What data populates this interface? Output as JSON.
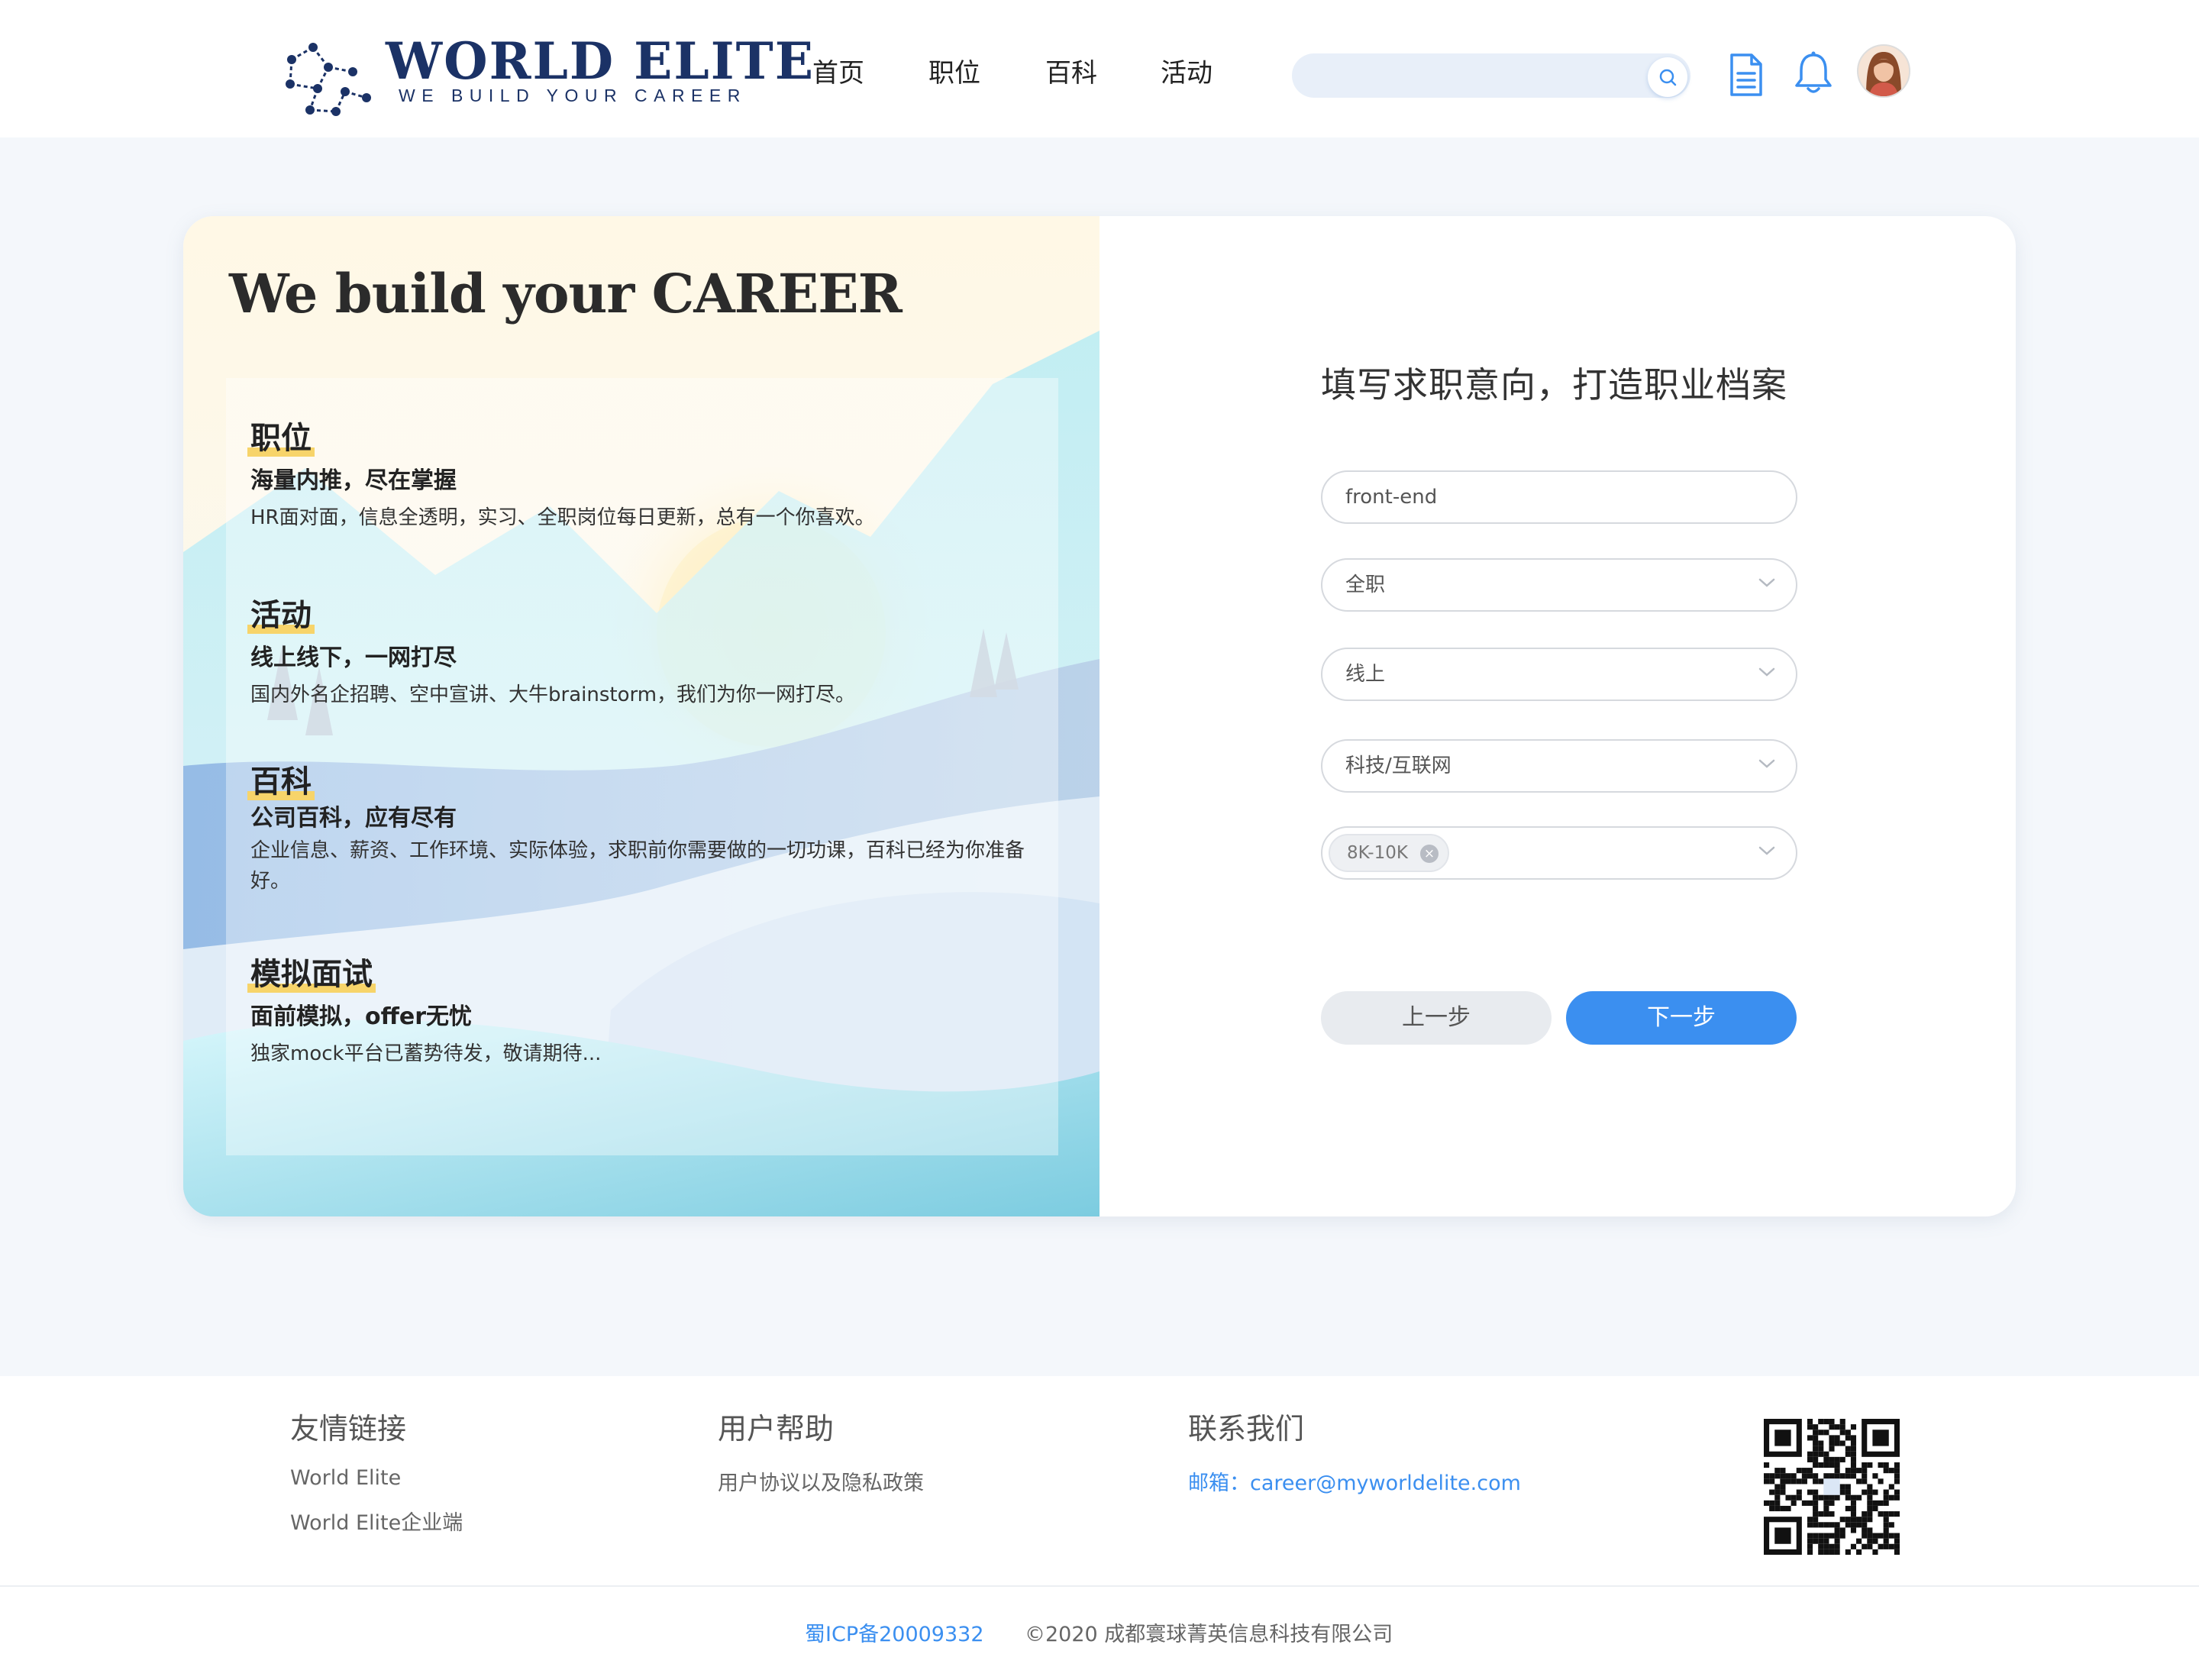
{
  "header": {
    "logo_title": "WORLD ELITE",
    "logo_subtitle": "WE BUILD YOUR CAREER",
    "nav": [
      "首页",
      "职位",
      "百科",
      "活动"
    ],
    "search_placeholder": ""
  },
  "hero": {
    "headline": "We build your CAREER",
    "features": [
      {
        "title": "职位",
        "subtitle": "海量内推，尽在掌握",
        "desc": "HR面对面，信息全透明，实习、全职岗位每日更新，总有一个你喜欢。"
      },
      {
        "title": "活动",
        "subtitle": "线上线下，一网打尽",
        "desc": "国内外名企招聘、空中宣讲、大牛brainstorm，我们为你一网打尽。"
      },
      {
        "title": "百科",
        "subtitle": "公司百科，应有尽有",
        "desc": "企业信息、薪资、工作环境、实际体验，求职前你需要做的一切功课，百科已经为你准备好。"
      },
      {
        "title": "模拟面试",
        "subtitle": "面前模拟，offer无忧",
        "desc": "独家mock平台已蓄势待发，敬请期待..."
      }
    ]
  },
  "form": {
    "title": "填写求职意向，打造职业档案",
    "position_value": "front-end",
    "job_type": "全职",
    "work_mode": "线上",
    "industry": "科技/互联网",
    "salary_tag": "8K-10K",
    "prev_label": "上一步",
    "next_label": "下一步"
  },
  "footer": {
    "friends_title": "友情链接",
    "friends_links": [
      "World Elite",
      "World Elite企业端"
    ],
    "help_title": "用户帮助",
    "help_link": "用户协议以及隐私政策",
    "contact_title": "联系我们",
    "email_label": "邮箱：",
    "email": "career@myworldelite.com",
    "icp": "蜀ICP备20009332",
    "copyright": "©2020 成都寰球菁英信息科技有限公司"
  },
  "colors": {
    "brand": "#1b3266",
    "accent": "#3b8ff0",
    "highlight": "#f7d46a"
  },
  "icons": [
    "logo-network-icon",
    "search-icon",
    "document-icon",
    "bell-icon",
    "chevron-down-icon",
    "tag-close-icon",
    "qr-code"
  ]
}
